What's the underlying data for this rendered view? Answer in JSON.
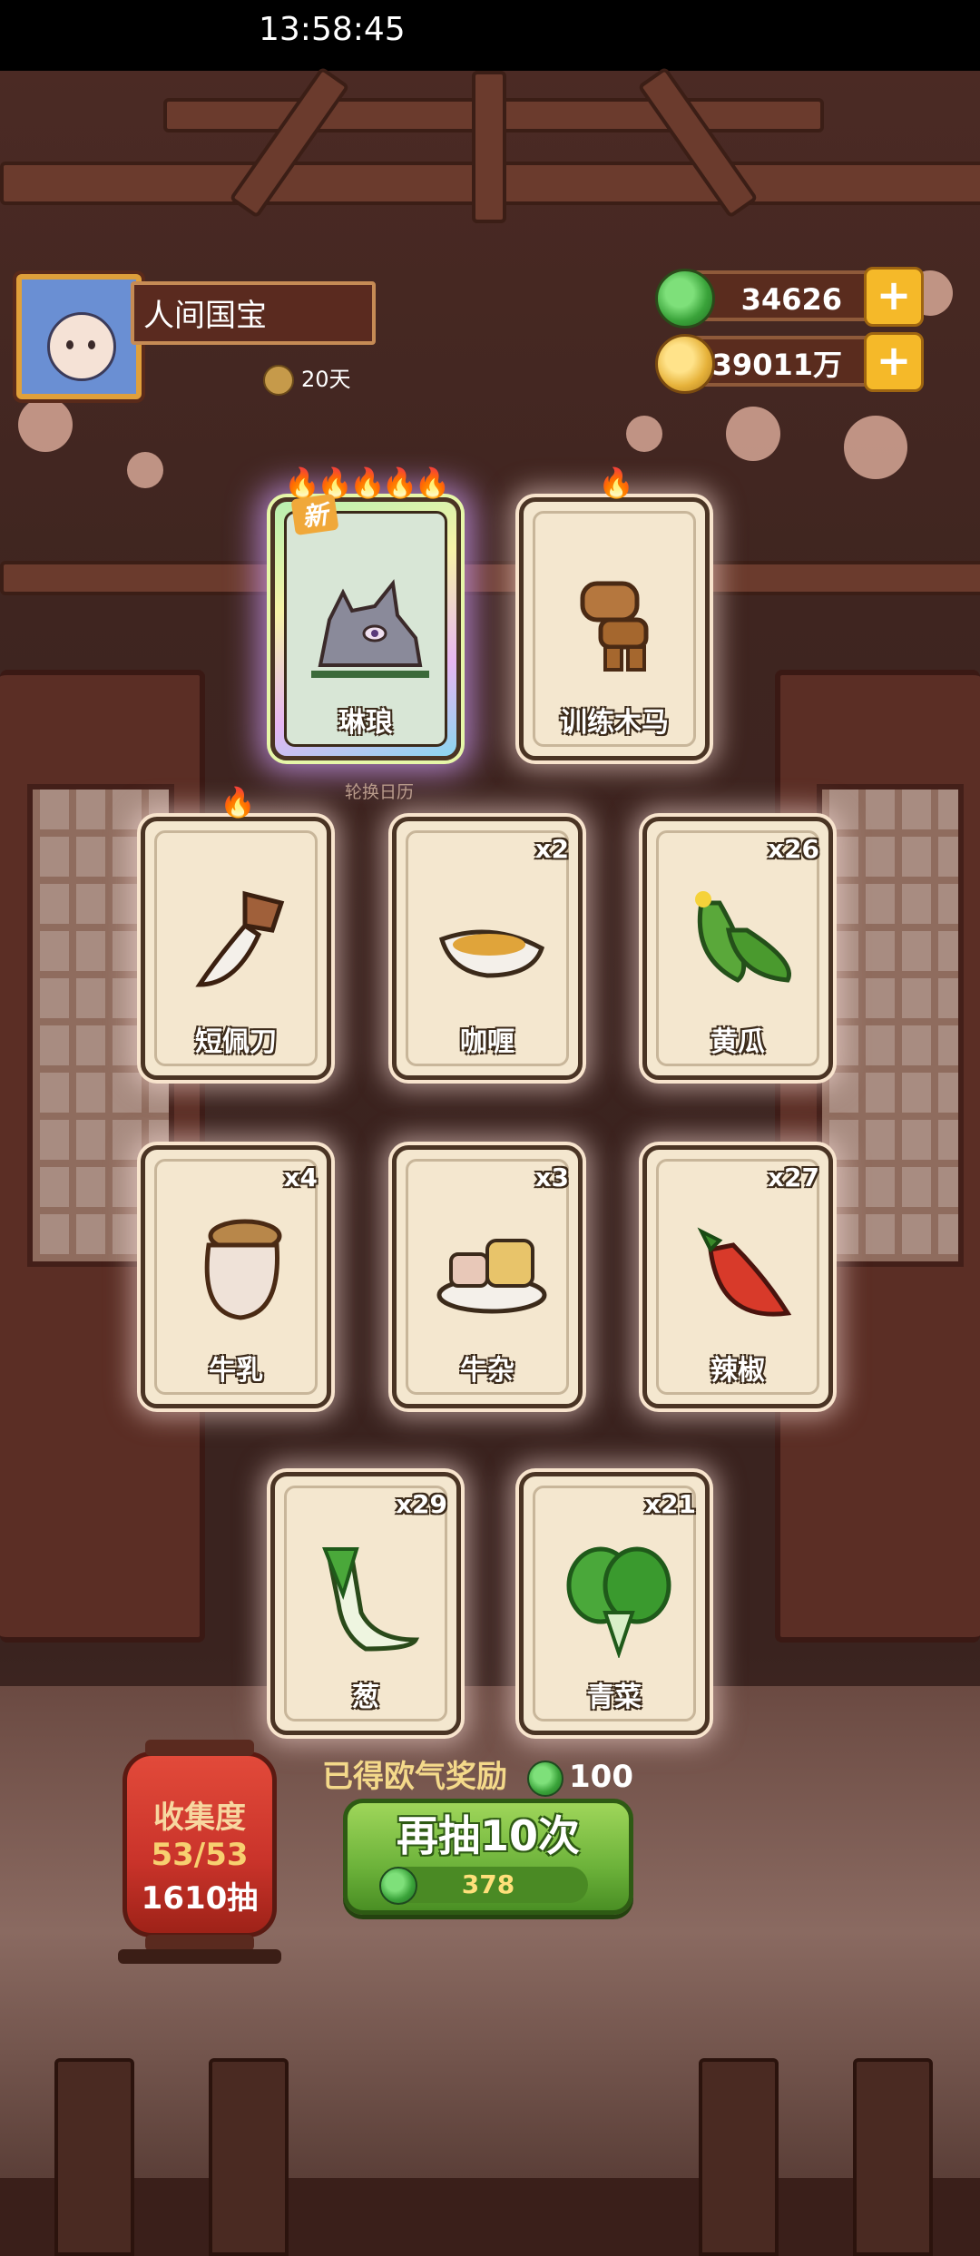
{
  "status_bar": {
    "time": "13:58:45"
  },
  "player": {
    "name": "人间国宝",
    "days": "20天"
  },
  "currency": {
    "jade": "34626",
    "coins": "39011万",
    "plus": "+"
  },
  "featured": {
    "caption": "轮换日历",
    "cards": [
      {
        "label": "琳琅",
        "badge": "新",
        "flames": "🔥🔥🔥🔥🔥",
        "icon": "wolf-icon"
      },
      {
        "label": "训练木马",
        "flames": "🔥",
        "icon": "wooden-horse-icon"
      }
    ]
  },
  "cards": [
    {
      "label": "短佩刀",
      "count": "",
      "flames": "🔥",
      "icon": "dagger-icon"
    },
    {
      "label": "咖喱",
      "count": "x2",
      "icon": "curry-icon"
    },
    {
      "label": "黄瓜",
      "count": "x26",
      "icon": "cucumber-icon"
    },
    {
      "label": "牛乳",
      "count": "x4",
      "icon": "milk-jar-icon"
    },
    {
      "label": "牛杂",
      "count": "x3",
      "icon": "beef-offal-icon"
    },
    {
      "label": "辣椒",
      "count": "x27",
      "icon": "chili-icon"
    },
    {
      "label": "葱",
      "count": "x29",
      "icon": "scallion-icon"
    },
    {
      "label": "青菜",
      "count": "x21",
      "icon": "greens-icon"
    }
  ],
  "reward": {
    "text": "已得欧气奖励",
    "value": "100"
  },
  "draw_button": {
    "label": "再抽10次",
    "cost": "378"
  },
  "collection": {
    "title": "收集度",
    "progress": "53/53",
    "draws": "1610抽"
  }
}
